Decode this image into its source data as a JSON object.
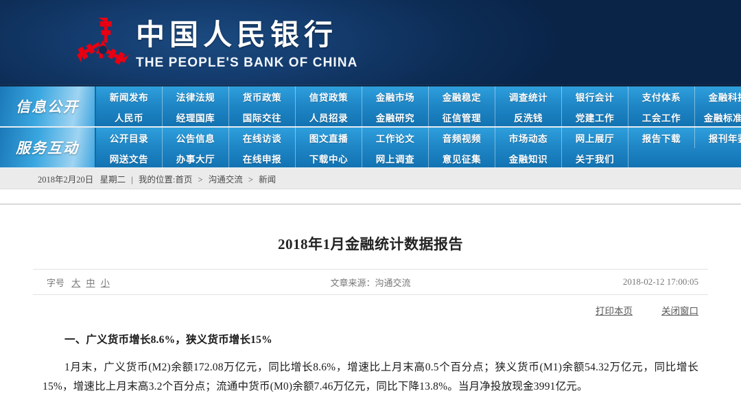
{
  "header": {
    "logo_icon": "pboc-tri-coin-logo",
    "name_cn": "中国人民银行",
    "name_en": "THE PEOPLE'S BANK OF CHINA",
    "brand_red": "#e60012",
    "banner_blue": "#0d2d56"
  },
  "nav": {
    "groups": [
      {
        "label": "信息公开",
        "cells": [
          "新闻发布",
          "法律法规",
          "货币政策",
          "信贷政策",
          "金融市场",
          "金融稳定",
          "调查统计",
          "银行会计",
          "支付体系",
          "金融科技",
          "人民币",
          "经理国库",
          "国际交往",
          "人员招录",
          "金融研究",
          "征信管理",
          "反洗钱",
          "党建工作",
          "工会工作",
          "金融标准化"
        ]
      },
      {
        "label": "服务互动",
        "cells": [
          "公开目录",
          "公告信息",
          "在线访谈",
          "图文直播",
          "工作论文",
          "音频视频",
          "市场动态",
          "网上展厅",
          "报告下载",
          "报刊年鉴",
          "网送文告",
          "办事大厅",
          "在线申报",
          "下载中心",
          "网上调查",
          "意见征集",
          "金融知识",
          "关于我们",
          "",
          ""
        ]
      }
    ],
    "accent_blue": "#1f86c6"
  },
  "breadcrumb": {
    "date": "2018年2月20日",
    "weekday": "星期二",
    "divider": "|",
    "position_label": "我的位置:",
    "path": [
      "首页",
      "沟通交流",
      "新闻"
    ],
    "separator": ">"
  },
  "article": {
    "title": "2018年1月金融统计数据报告",
    "font_size_label": "字号",
    "font_size_options": [
      "大",
      "中",
      "小"
    ],
    "source_label": "文章来源：",
    "source_value": "沟通交流",
    "timestamp": "2018-02-12 17:00:05",
    "print_link": "打印本页",
    "close_link": "关闭窗口",
    "heading": "一、广义货币增长8.6%，狭义货币增长15%",
    "paragraph": "1月末，广义货币(M2)余额172.08万亿元，同比增长8.6%，增速比上月末高0.5个百分点；狭义货币(M1)余额54.32万亿元，同比增长15%，增速比上月末高3.2个百分点；流通中货币(M0)余额7.46万亿元，同比下降13.8%。当月净投放现金3991亿元。"
  }
}
